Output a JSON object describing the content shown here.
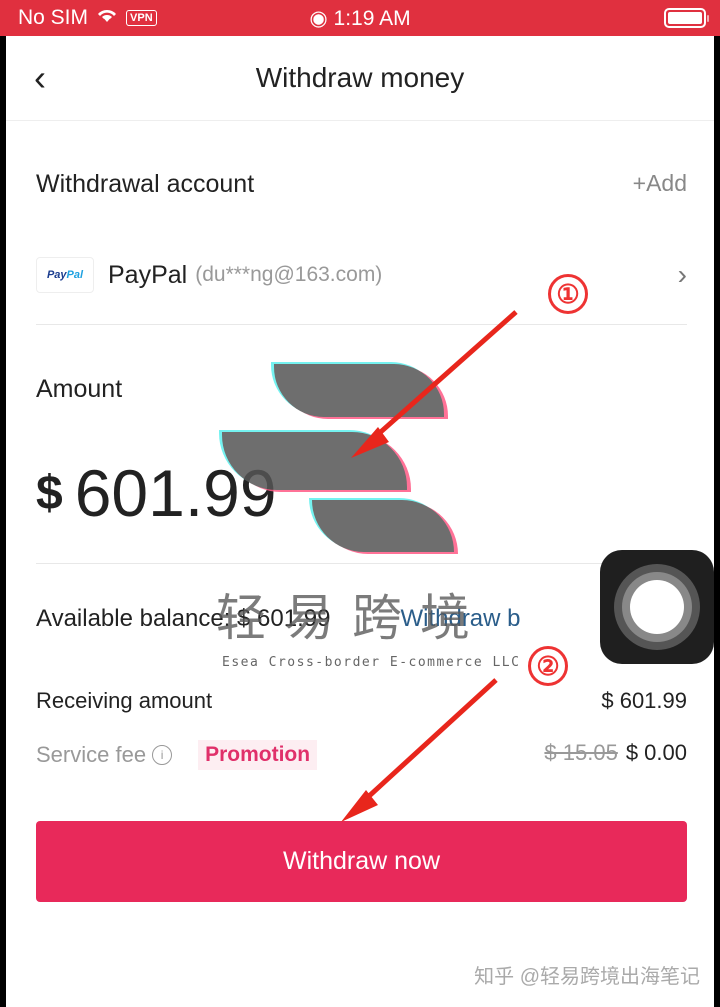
{
  "status_bar": {
    "carrier": "No SIM",
    "vpn": "VPN",
    "time": "1:19 AM"
  },
  "nav": {
    "back_icon": "‹",
    "title": "Withdraw money"
  },
  "withdrawal_account": {
    "label": "Withdrawal account",
    "add_label": "+Add",
    "account": {
      "logo_text_a": "Pay",
      "logo_text_b": "Pal",
      "name": "PayPal",
      "email": "(du***ng@163.com)",
      "chevron": "›"
    }
  },
  "amount": {
    "label": "Amount",
    "currency": "$",
    "value": "601.99"
  },
  "available": {
    "text": "Available balance: $ 601.99",
    "link": "Withdraw b"
  },
  "receiving": {
    "label": "Receiving amount",
    "value": "$ 601.99"
  },
  "service_fee": {
    "label": "Service fee",
    "info_icon": "i",
    "promo": "Promotion",
    "old_value": "$ 15.05",
    "value": "$ 0.00"
  },
  "cta": {
    "label": "Withdraw now"
  },
  "annotations": {
    "step1": "①",
    "step2": "②"
  },
  "watermarks": {
    "cn": "轻易跨境",
    "en": "Esea Cross-border E-commerce LLC",
    "zhihu": "知乎 @轻易跨境出海笔记"
  },
  "colors": {
    "status_bar": "#e0303f",
    "primary": "#e8295a",
    "link": "#2a5d8a"
  }
}
